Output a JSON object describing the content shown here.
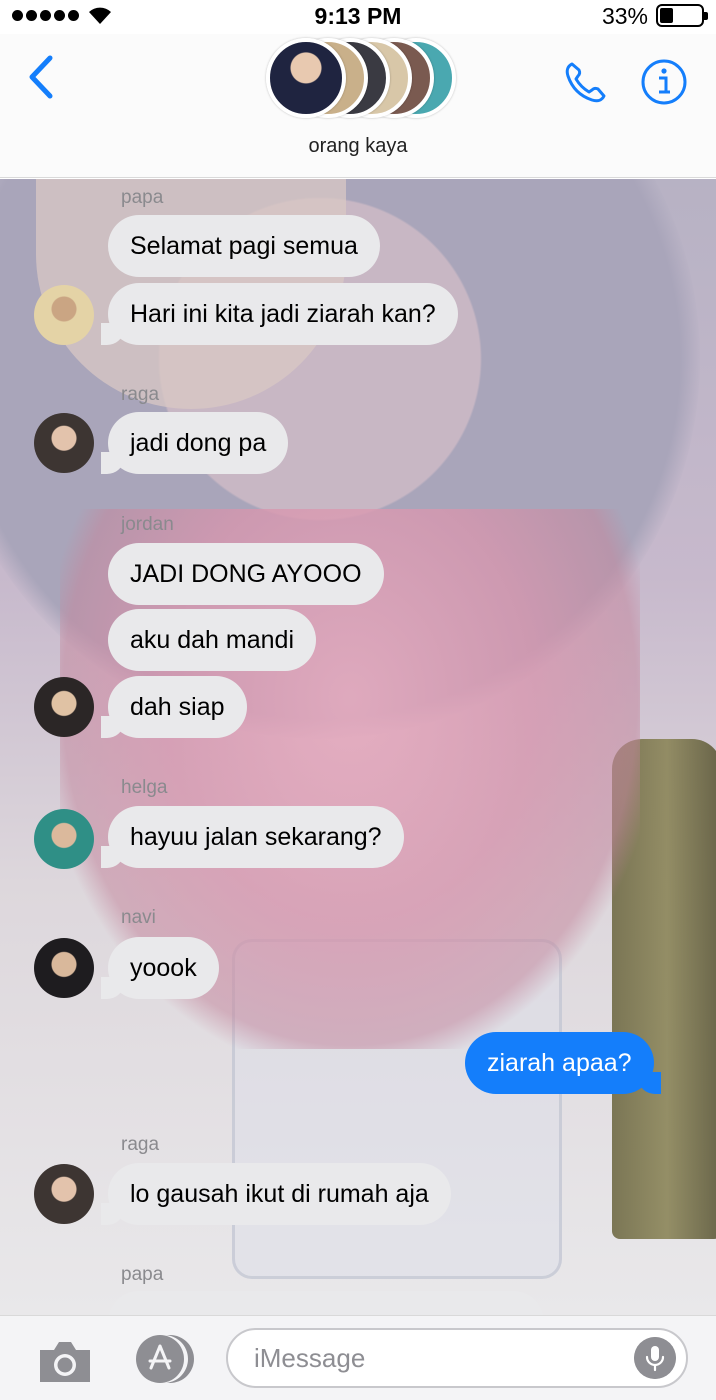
{
  "status_bar": {
    "time": "9:13 PM",
    "battery": "33%"
  },
  "header": {
    "group_name": "orang kaya"
  },
  "messages": {
    "s1": "papa",
    "m1": "Selamat pagi semua",
    "m2": "Hari ini kita jadi ziarah kan?",
    "s2": "raga",
    "m3": "jadi dong pa",
    "s3": "jordan",
    "m4": "JADI DONG AYOOO",
    "m5": "aku dah mandi",
    "m6": "dah siap",
    "s4": "helga",
    "m7": "hayuu jalan sekarang?",
    "s5": "navi",
    "m8": "yoook",
    "m9": "ziarah apaa?",
    "s6": "raga",
    "m10": "lo gausah ikut di rumah aja",
    "s7": "papa"
  },
  "input": {
    "placeholder": "iMessage"
  },
  "colors": {
    "accent": "#147efb",
    "incoming_bubble": "#e9e9eb",
    "sender_label": "#8a8a8e"
  },
  "icons": [
    "signal-icon",
    "wifi-icon",
    "battery-icon",
    "back-chevron-icon",
    "phone-icon",
    "info-icon",
    "camera-icon",
    "app-store-icon",
    "microphone-icon"
  ]
}
